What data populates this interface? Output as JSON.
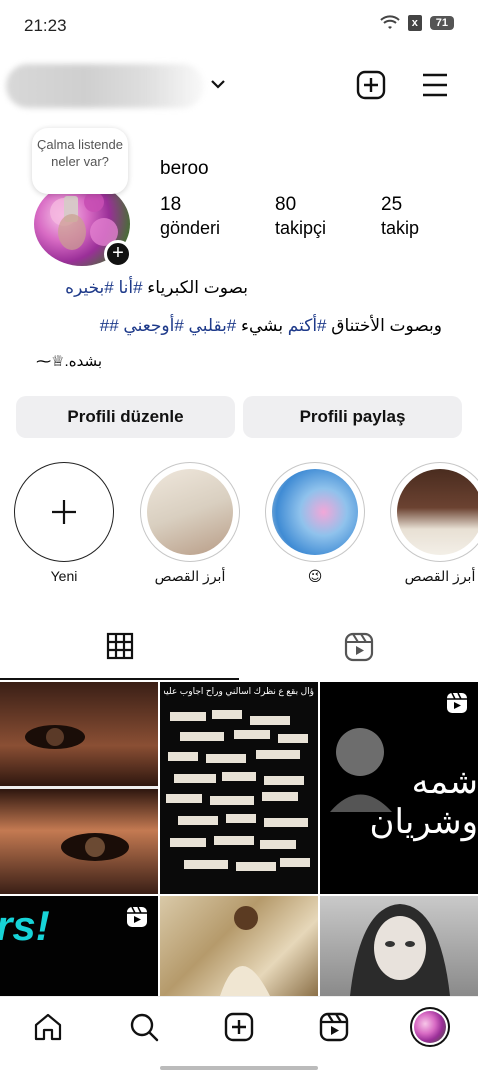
{
  "status_bar": {
    "time": "21:23",
    "battery": "71"
  },
  "profile": {
    "name": "beroo",
    "note_bubble": "Çalma listende neler var?",
    "stats": [
      {
        "value": "18",
        "label": "gönderi"
      },
      {
        "value": "80",
        "label": "takipçi"
      },
      {
        "value": "25",
        "label": "takip"
      }
    ]
  },
  "bio": {
    "line1_tag1": "#بخيره",
    "line1_tag2": "#أنا",
    "line1_text": "بصوت الكبرياء",
    "line2_tag1": "##",
    "line2_tag2": "#أوجعني",
    "line2_tag3": "#بقلبي",
    "line2_text1": "بشيء",
    "line2_tag4": "#أكتم",
    "line2_text2": "وبصوت الأختناق",
    "line3": "بشده.♕⁓"
  },
  "buttons": {
    "edit_profile": "Profili düzenle",
    "share_profile": "Profili paylaş"
  },
  "highlights": [
    {
      "label": "Yeni"
    },
    {
      "label": "أبرز القصص"
    },
    {
      "label": "😉"
    },
    {
      "label": "أبرز القصص"
    }
  ],
  "grid": {
    "post2_header": "ؤال بقع ع نظرك اسالني وراح اجاوب عليه .",
    "post3_text": "شمه وشريان",
    "post4_text": "rs!"
  },
  "colors": {
    "hashtag": "#1e3a8a",
    "button_bg": "#efeff1"
  }
}
